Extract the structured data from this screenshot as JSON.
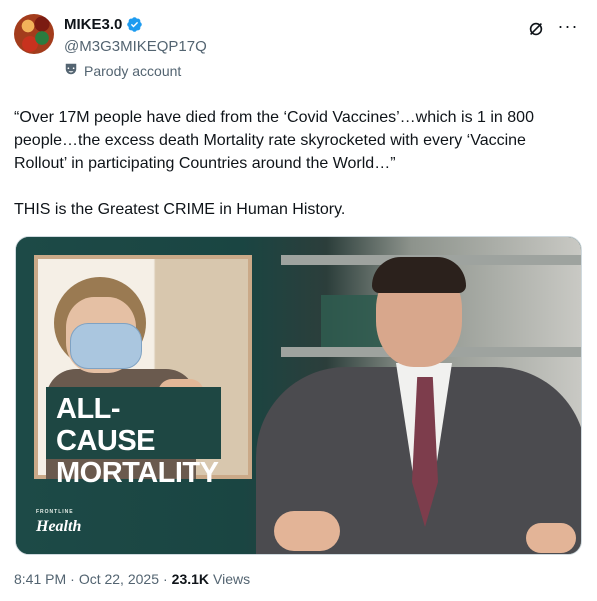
{
  "author": {
    "name": "MIKE3.0",
    "handle": "@M3G3MIKEQP17Q",
    "parody_label": "Parody account"
  },
  "post": {
    "text": "“Over 17M people have died from the ‘Covid Vaccines’…which is 1 in 800 people…the excess death Mortality rate skyrocketed with every ‘Vaccine Rollout’ in participating Countries around the World…”\n\nTHIS is the Greatest CRIME in Human History."
  },
  "media": {
    "overlay_text": "ALL-CAUSE MORTALITY",
    "brand_small": "FRONTLINE",
    "brand": "Health"
  },
  "meta": {
    "time": "8:41 PM",
    "separator1": "·",
    "date": "Oct 22, 2025",
    "separator2": "·",
    "views_count": "23.1K",
    "views_label": "Views"
  },
  "icons": {
    "verified": "verified-badge-icon",
    "grok": "grok-icon",
    "more": "more-icon",
    "parody": "parody-mask-icon"
  },
  "colors": {
    "verified_blue": "#1d9bf0",
    "secondary_text": "#536471"
  }
}
